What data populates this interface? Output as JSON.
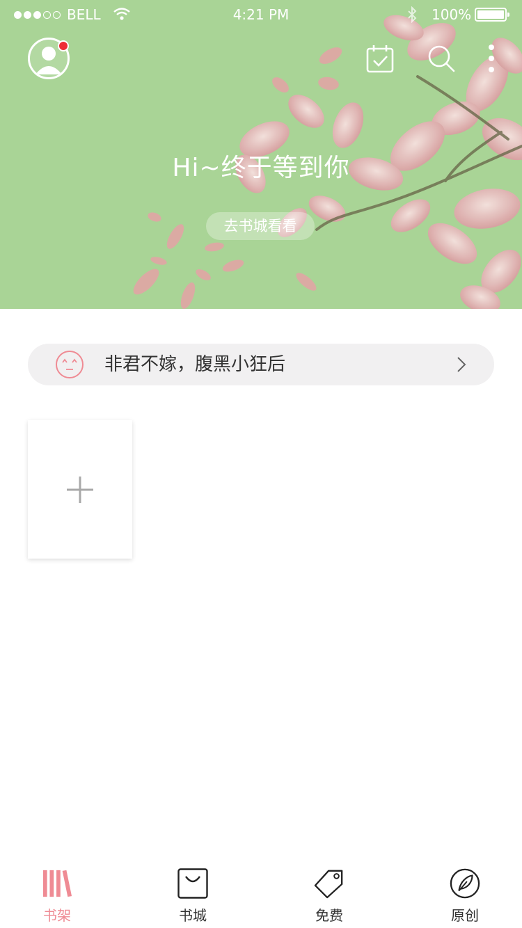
{
  "status_bar": {
    "carrier": "BELL",
    "time": "4:21 PM",
    "battery": "100%"
  },
  "header": {
    "avatar_icon": "user-avatar-icon",
    "has_notification": true,
    "notification_color": "#ee2c35",
    "actions": [
      "calendar-check-icon",
      "search-icon",
      "more-vertical-icon"
    ]
  },
  "hero": {
    "title": "Hi~终于等到你",
    "cta": "去书城看看",
    "background_color": "#a9d496"
  },
  "banner": {
    "icon": "smiley-face-icon",
    "text": "非君不嫁，腹黑小狂后"
  },
  "shelf": {
    "add_icon": "plus-icon"
  },
  "tabs": [
    {
      "label": "书架",
      "icon": "bookshelf-icon",
      "active": true
    },
    {
      "label": "书城",
      "icon": "shopping-bag-icon",
      "active": false
    },
    {
      "label": "免费",
      "icon": "tag-icon",
      "active": false
    },
    {
      "label": "原创",
      "icon": "leaf-circle-icon",
      "active": false
    }
  ],
  "colors": {
    "accent": "#ef8b94",
    "flower": "#e2a9ab",
    "text": "#333333",
    "banner_bg": "#f1f0f1"
  }
}
